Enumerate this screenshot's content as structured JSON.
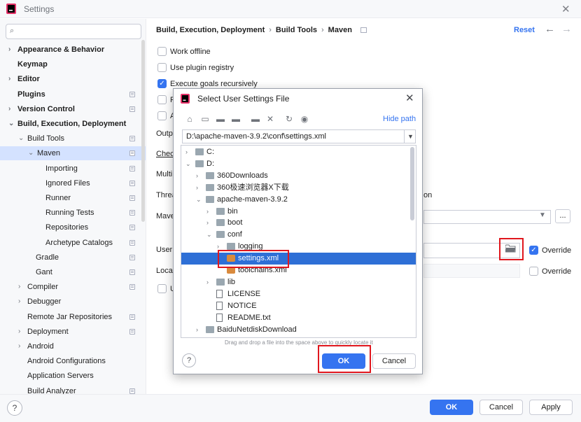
{
  "window": {
    "title": "Settings"
  },
  "sidebar": {
    "search_placeholder": "",
    "items": [
      {
        "label": "Appearance & Behavior",
        "bold": true,
        "chevron": "›",
        "page": false
      },
      {
        "label": "Keymap",
        "bold": true,
        "chevron": "",
        "page": false
      },
      {
        "label": "Editor",
        "bold": true,
        "chevron": "›",
        "page": false
      },
      {
        "label": "Plugins",
        "bold": true,
        "chevron": "",
        "page": true
      },
      {
        "label": "Version Control",
        "bold": true,
        "chevron": "›",
        "page": true
      },
      {
        "label": "Build, Execution, Deployment",
        "bold": true,
        "chevron": "⌄",
        "page": false
      },
      {
        "label": "Build Tools",
        "bold": false,
        "chevron": "⌄",
        "page": true
      },
      {
        "label": "Maven",
        "bold": false,
        "chevron": "⌄",
        "page": true,
        "selected": true
      },
      {
        "label": "Importing",
        "bold": false,
        "chevron": "",
        "page": true
      },
      {
        "label": "Ignored Files",
        "bold": false,
        "chevron": "",
        "page": true
      },
      {
        "label": "Runner",
        "bold": false,
        "chevron": "",
        "page": true
      },
      {
        "label": "Running Tests",
        "bold": false,
        "chevron": "",
        "page": true
      },
      {
        "label": "Repositories",
        "bold": false,
        "chevron": "",
        "page": true
      },
      {
        "label": "Archetype Catalogs",
        "bold": false,
        "chevron": "",
        "page": true
      },
      {
        "label": "Gradle",
        "bold": false,
        "chevron": "",
        "page": true
      },
      {
        "label": "Gant",
        "bold": false,
        "chevron": "",
        "page": true
      },
      {
        "label": "Compiler",
        "bold": false,
        "chevron": "›",
        "page": true
      },
      {
        "label": "Debugger",
        "bold": false,
        "chevron": "›",
        "page": false
      },
      {
        "label": "Remote Jar Repositories",
        "bold": false,
        "chevron": "",
        "page": true
      },
      {
        "label": "Deployment",
        "bold": false,
        "chevron": "›",
        "page": true
      },
      {
        "label": "Android",
        "bold": false,
        "chevron": "›",
        "page": false
      },
      {
        "label": "Android Configurations",
        "bold": false,
        "chevron": "",
        "page": false
      },
      {
        "label": "Application Servers",
        "bold": false,
        "chevron": "",
        "page": false
      },
      {
        "label": "Build Analyzer",
        "bold": false,
        "chevron": "",
        "page": true
      }
    ]
  },
  "breadcrumb": {
    "parts": [
      "Build, Execution, Deployment",
      "Build Tools",
      "Maven"
    ],
    "sep": "›"
  },
  "header": {
    "reset": "Reset",
    "back": "←",
    "forward": "→"
  },
  "options": {
    "work_offline": "Work offline",
    "plugin_registry": "Use plugin registry",
    "execute_goals": "Execute goals recursively",
    "cut_p": "P",
    "cut_a": "A",
    "cut_u": "U",
    "output": "Outp",
    "checksum": "Check",
    "multi": "Multi",
    "threads": "Threa",
    "threads_suffix": "on",
    "maven_home": "Mave",
    "user_settings": "User",
    "local_repo": "Local",
    "override": "Override",
    "browse": "..."
  },
  "footer": {
    "help": "?",
    "ok": "OK",
    "cancel": "Cancel",
    "apply": "Apply"
  },
  "dialog": {
    "title": "Select User Settings File",
    "hide_path": "Hide path",
    "path": "D:\\apache-maven-3.9.2\\conf\\settings.xml",
    "drag_hint": "Drag and drop a file into the space above to quickly locate it",
    "help": "?",
    "ok": "OK",
    "cancel": "Cancel",
    "tree": [
      {
        "label": "C:",
        "chevron": "›",
        "icon": "folder",
        "depth": 0
      },
      {
        "label": "D:",
        "chevron": "⌄",
        "icon": "folder",
        "depth": 0
      },
      {
        "label": "360Downloads",
        "chevron": "›",
        "icon": "folder",
        "depth": 1
      },
      {
        "label": "360极速浏览器X下载",
        "chevron": "›",
        "icon": "folder",
        "depth": 1
      },
      {
        "label": "apache-maven-3.9.2",
        "chevron": "⌄",
        "icon": "folder",
        "depth": 1
      },
      {
        "label": "bin",
        "chevron": "›",
        "icon": "folder",
        "depth": 2
      },
      {
        "label": "boot",
        "chevron": "›",
        "icon": "folder",
        "depth": 2
      },
      {
        "label": "conf",
        "chevron": "⌄",
        "icon": "folder",
        "depth": 2
      },
      {
        "label": "logging",
        "chevron": "›",
        "icon": "folder",
        "depth": 3
      },
      {
        "label": "settings.xml",
        "chevron": "",
        "icon": "xml",
        "depth": 3,
        "selected": true
      },
      {
        "label": "toolchains.xml",
        "chevron": "",
        "icon": "xml",
        "depth": 3
      },
      {
        "label": "lib",
        "chevron": "›",
        "icon": "folder",
        "depth": 2
      },
      {
        "label": "LICENSE",
        "chevron": "",
        "icon": "file",
        "depth": 2
      },
      {
        "label": "NOTICE",
        "chevron": "",
        "icon": "file",
        "depth": 2
      },
      {
        "label": "README.txt",
        "chevron": "",
        "icon": "file",
        "depth": 2
      },
      {
        "label": "BaiduNetdiskDownload",
        "chevron": "›",
        "icon": "folder",
        "depth": 1
      }
    ]
  },
  "colors": {
    "accent": "#3574f0",
    "selection": "#d4e2ff",
    "tree_selection": "#2e6fd6",
    "highlight": "#e0171e"
  }
}
